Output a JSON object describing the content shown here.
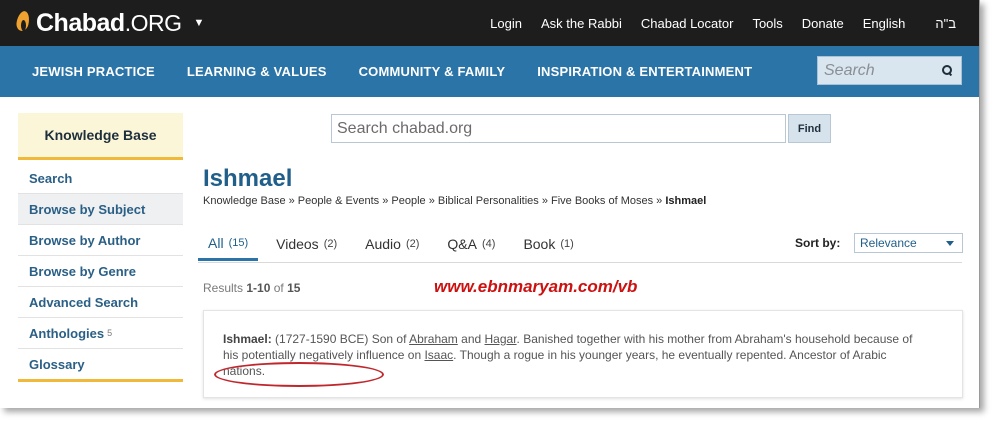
{
  "brand": {
    "name": "Chabad",
    "suffix": ".ORG",
    "accent": "#f0a230"
  },
  "topnav": [
    "Login",
    "Ask the Rabbi",
    "Chabad Locator",
    "Tools",
    "Donate",
    "English",
    "ב\"ה"
  ],
  "mainnav": [
    "JEWISH PRACTICE",
    "LEARNING & VALUES",
    "COMMUNITY & FAMILY",
    "INSPIRATION & ENTERTAINMENT"
  ],
  "topsearch": {
    "placeholder": "Search"
  },
  "sidebar": {
    "title": "Knowledge Base",
    "items": [
      {
        "label": "Search"
      },
      {
        "label": "Browse by Subject"
      },
      {
        "label": "Browse by Author"
      },
      {
        "label": "Browse by Genre"
      },
      {
        "label": "Advanced Search"
      },
      {
        "label": "Anthologies",
        "badge": "5"
      },
      {
        "label": "Glossary"
      }
    ]
  },
  "mainsearch": {
    "placeholder": "Search chabad.org",
    "button": "Find"
  },
  "page": {
    "title": "Ishmael",
    "breadcrumb": [
      "Knowledge Base",
      "People & Events",
      "People",
      "Biblical Personalities",
      "Five Books of Moses",
      "Ishmael"
    ]
  },
  "tabs": [
    {
      "label": "All",
      "count": "(15)"
    },
    {
      "label": "Videos",
      "count": "(2)"
    },
    {
      "label": "Audio",
      "count": "(2)"
    },
    {
      "label": "Q&A",
      "count": "(4)"
    },
    {
      "label": "Book",
      "count": "(1)"
    }
  ],
  "sort": {
    "label": "Sort by:",
    "value": "Relevance"
  },
  "results": {
    "prefix": "Results",
    "range": "1-10",
    "of": "of",
    "total": "15"
  },
  "watermark": "www.ebnmaryam.com/vb",
  "result_card": {
    "term": "Ishmael:",
    "t1": " (1727-1590 BCE) Son of ",
    "l1": "Abraham",
    "t2": " and ",
    "l2": "Hagar",
    "t3": ". Banished together with his mother from Abraham's household because of his potentially negatively influence on ",
    "l3": "Isaac",
    "t4": ". Though a rogue in his younger years, he eventually repented. Ancestor of Arabic nations."
  },
  "colors": {
    "topbar": "#1d1d1d",
    "navbar": "#2a74a7",
    "title": "#1f5f8a",
    "highlight": "#f0b93a",
    "annotation": "#c0272d"
  }
}
